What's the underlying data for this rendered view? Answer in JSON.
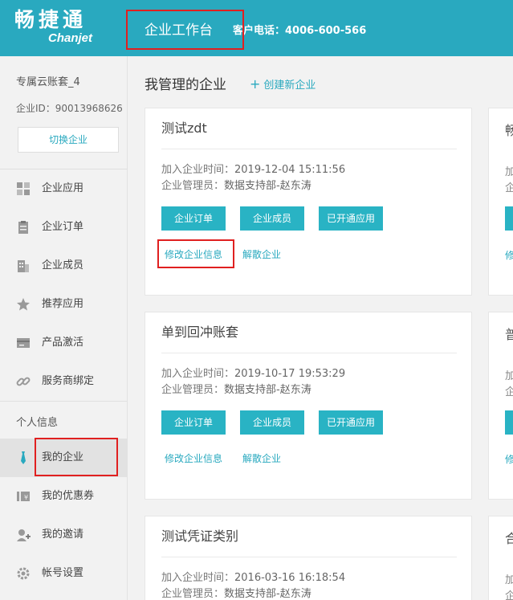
{
  "header": {
    "logo_cn": "畅捷通",
    "logo_en": "Chanjet",
    "workspace_title": "企业工作台",
    "phone": "客户电话：4006-600-566"
  },
  "sidebar": {
    "account_name": "专属云账套_4",
    "enterprise_id": "企业ID：90013968626",
    "switch_button": "切换企业",
    "section_personal": "个人信息",
    "items": [
      {
        "label": "企业应用",
        "icon": "grid-icon"
      },
      {
        "label": "企业订单",
        "icon": "clipboard-icon"
      },
      {
        "label": "企业成员",
        "icon": "building-icon"
      },
      {
        "label": "推荐应用",
        "icon": "star-icon"
      },
      {
        "label": "产品激活",
        "icon": "card-icon"
      },
      {
        "label": "服务商绑定",
        "icon": "link-icon"
      },
      {
        "label": "我的企业",
        "icon": "tie-icon"
      },
      {
        "label": "我的优惠券",
        "icon": "coupon-icon"
      },
      {
        "label": "我的邀请",
        "icon": "user-plus-icon"
      },
      {
        "label": "帐号设置",
        "icon": "gear-icon"
      }
    ],
    "active": "我的企业"
  },
  "main": {
    "title": "我管理的企业",
    "create_link": "创建新企业",
    "cards": [
      {
        "name": "测试zdt",
        "join_time_label": "加入企业时间：",
        "join_time": "2019-12-04 15:11:56",
        "admin_label": "企业管理员：",
        "admin": "数据支持部-赵东涛"
      },
      {
        "name": "单到回冲账套",
        "join_time_label": "加入企业时间：",
        "join_time": "2019-10-17 19:53:29",
        "admin_label": "企业管理员：",
        "admin": "数据支持部-赵东涛"
      },
      {
        "name": "测试凭证类别",
        "join_time_label": "加入企业时间：",
        "join_time": "2016-03-16 16:18:54",
        "admin_label": "企业管理员：",
        "admin": "数据支持部-赵东涛"
      }
    ],
    "buttons": {
      "orders": "企业订单",
      "members": "企业成员",
      "apps": "已开通应用"
    },
    "links": {
      "edit": "修改企业信息",
      "dissolve": "解散企业"
    },
    "partial_cards": [
      {
        "name": "畅",
        "meta1": "加",
        "meta2": "企",
        "link": "修"
      },
      {
        "name": "普",
        "meta1": "加",
        "meta2": "企",
        "link": "修"
      },
      {
        "name": "合",
        "meta1": "加",
        "meta2": "企"
      }
    ]
  },
  "colors": {
    "accent": "#29a9bf",
    "button": "#29b3c4",
    "highlight": "#e02020"
  }
}
